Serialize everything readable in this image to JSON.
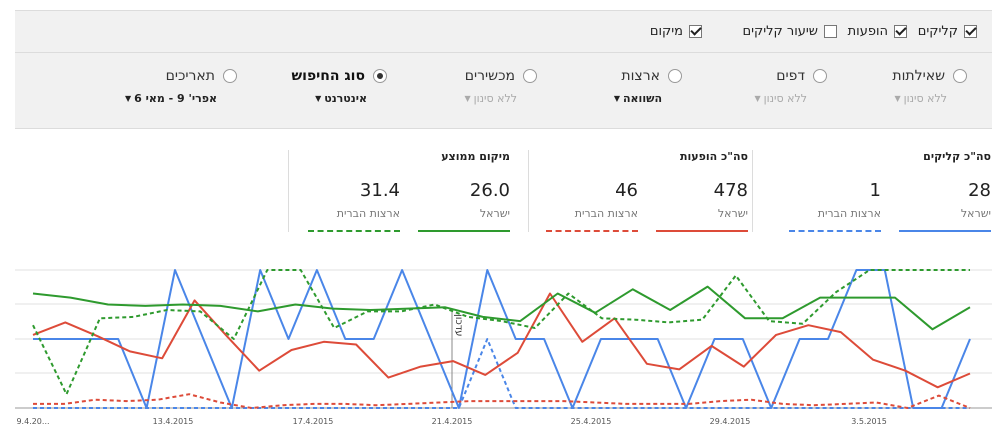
{
  "metric_checks": [
    {
      "label": "קליקים",
      "checked": true
    },
    {
      "label": "הופעות",
      "checked": true
    },
    {
      "label": "שיעור קליקים",
      "checked": false
    },
    {
      "label": "מיקום",
      "checked": true
    }
  ],
  "dimensions": [
    {
      "label": "שאילתות",
      "sub": "ללא סינון",
      "selected": false,
      "active": false
    },
    {
      "label": "דפים",
      "sub": "ללא סינון",
      "selected": false,
      "active": false
    },
    {
      "label": "ארצות",
      "sub": "השוואה",
      "selected": false,
      "active": true
    },
    {
      "label": "מכשירים",
      "sub": "ללא סינון",
      "selected": false,
      "active": false
    },
    {
      "label": "סוג החיפוש",
      "sub": "אינטרנט",
      "selected": true,
      "active": true
    },
    {
      "label": "תאריכים",
      "sub": "אפרי' 9 - מאי 6",
      "selected": false,
      "active": true
    }
  ],
  "summary": {
    "clicks": {
      "title": "סה\"כ קליקים",
      "israel_value": "28",
      "israel_label": "ישראל",
      "us_value": "1",
      "us_label": "ארצות הברית"
    },
    "impressions": {
      "title": "סה\"כ הופעות",
      "israel_value": "478",
      "israel_label": "ישראל",
      "us_value": "46",
      "us_label": "ארצות הברית"
    },
    "position": {
      "title": "מיקום ממוצע",
      "israel_value": "26.0",
      "israel_label": "ישראל",
      "us_value": "31.4",
      "us_label": "ארצות הברית"
    }
  },
  "colors": {
    "clicks": "#4a86e8",
    "impressions": "#dd4b39",
    "position": "#2e9a2e"
  },
  "chart_data": {
    "type": "line",
    "x_labels": [
      "9.4.20...",
      "13.4.2015",
      "17.4.2015",
      "21.4.2015",
      "25.4.2015",
      "29.4.2015",
      "3.5.2015"
    ],
    "annotation": "עדכון",
    "y_axis_visible": false,
    "note": "Relative series values (0 = baseline, 100 = top of plot).",
    "series": [
      {
        "name": "ישראל",
        "metric": "clicks",
        "style": "solid",
        "color": "#4a86e8",
        "values": [
          50,
          50,
          50,
          50,
          0,
          100,
          50,
          0,
          100,
          50,
          100,
          50,
          50,
          100,
          50,
          0,
          100,
          50,
          50,
          0,
          50,
          50,
          50,
          0,
          50,
          50,
          0,
          50,
          50,
          100,
          100,
          0,
          0,
          50
        ]
      },
      {
        "name": "ארצות הברית",
        "metric": "clicks",
        "style": "dashed",
        "color": "#4a86e8",
        "values": [
          0,
          0,
          0,
          0,
          0,
          0,
          0,
          0,
          0,
          0,
          0,
          0,
          0,
          0,
          0,
          0,
          50,
          0,
          0,
          0,
          0,
          0,
          0,
          0,
          0,
          0,
          0,
          0,
          0,
          0,
          0,
          0,
          0,
          0
        ]
      },
      {
        "name": "ישראל",
        "metric": "impressions",
        "style": "solid",
        "color": "#dd4b39",
        "values": [
          53,
          62,
          52,
          41,
          36,
          78,
          52,
          27,
          42,
          48,
          46,
          22,
          30,
          34,
          24,
          40,
          83,
          48,
          65,
          32,
          28,
          45,
          30,
          53,
          60,
          55,
          35,
          27,
          15,
          25
        ]
      },
      {
        "name": "ארצות הברית",
        "metric": "impressions",
        "style": "dashed",
        "color": "#dd4b39",
        "values": [
          3,
          3,
          6,
          5,
          6,
          10,
          4,
          0,
          2,
          3,
          3,
          2,
          3,
          4,
          5,
          5,
          5,
          5,
          4,
          3,
          3,
          3,
          5,
          6,
          3,
          2,
          3,
          4,
          0,
          9,
          0
        ]
      },
      {
        "name": "ישראל",
        "metric": "position",
        "style": "solid",
        "color": "#2e9a2e",
        "values": [
          83,
          80,
          75,
          74,
          75,
          74,
          70,
          75,
          72,
          71,
          72,
          73,
          66,
          63,
          83,
          69,
          86,
          71,
          88,
          65,
          65,
          80,
          80,
          80,
          57,
          73
        ]
      },
      {
        "name": "ארצות הברית",
        "metric": "position",
        "style": "dashed",
        "color": "#2e9a2e",
        "values": [
          60,
          10,
          65,
          66,
          71,
          70,
          50,
          100,
          100,
          58,
          70,
          70,
          75,
          66,
          63,
          58,
          83,
          65,
          64,
          62,
          64,
          96,
          63,
          61,
          84,
          100,
          100,
          100,
          100
        ]
      }
    ]
  }
}
